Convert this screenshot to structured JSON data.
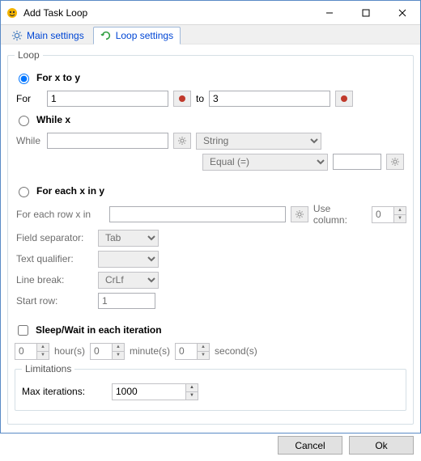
{
  "window": {
    "title": "Add Task Loop"
  },
  "tabs": {
    "main": "Main settings",
    "loop": "Loop settings"
  },
  "loop_group": {
    "legend": "Loop",
    "for_x_to_y": {
      "label": "For x to y",
      "for_label": "For",
      "from_value": "1",
      "to_label": "to",
      "to_value": "3"
    },
    "while_x": {
      "label": "While x",
      "while_label": "While",
      "while_value": "",
      "type_options": [
        "String"
      ],
      "type_selected": "String",
      "op_options": [
        "Equal (=)"
      ],
      "op_selected": "Equal (=)",
      "rhs_value": ""
    },
    "for_each": {
      "label": "For each x in y",
      "row_label": "For each row x in",
      "row_value": "",
      "use_column_label": "Use column:",
      "use_column_value": "0",
      "field_sep_label": "Field separator:",
      "field_sep_options": [
        "Tab"
      ],
      "field_sep_selected": "Tab",
      "text_qual_label": "Text qualifier:",
      "text_qual_options": [
        ""
      ],
      "text_qual_selected": "",
      "line_break_label": "Line break:",
      "line_break_options": [
        "CrLf"
      ],
      "line_break_selected": "CrLf",
      "start_row_label": "Start row:",
      "start_row_value": "1"
    },
    "sleep": {
      "checkbox_label": "Sleep/Wait in each iteration",
      "hours": "0",
      "hours_label": "hour(s)",
      "minutes": "0",
      "minutes_label": "minute(s)",
      "seconds": "0",
      "seconds_label": "second(s)"
    },
    "limitations": {
      "legend": "Limitations",
      "max_iter_label": "Max iterations:",
      "max_iter_value": "1000"
    }
  },
  "buttons": {
    "cancel": "Cancel",
    "ok": "Ok"
  }
}
